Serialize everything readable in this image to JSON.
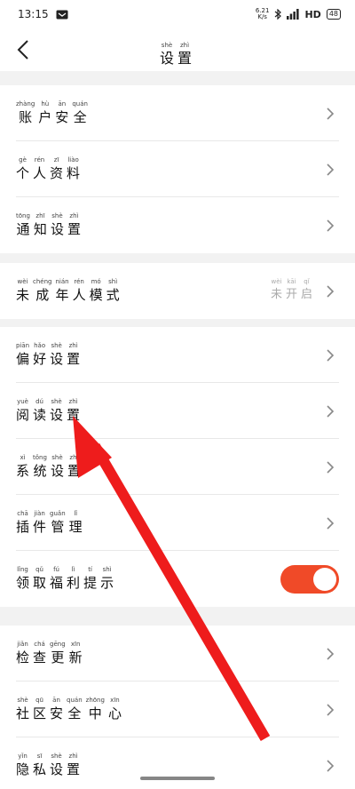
{
  "status": {
    "time": "13:15",
    "net_speed": "6.21",
    "net_unit": "K/s",
    "network": "HD",
    "battery": "48"
  },
  "header": {
    "title": [
      {
        "py": "shè",
        "hz": "设"
      },
      {
        "py": "zhì",
        "hz": "置"
      }
    ]
  },
  "groups": [
    {
      "items": [
        {
          "label": [
            {
              "py": "zhàng",
              "hz": "账"
            },
            {
              "py": "hù",
              "hz": "户"
            },
            {
              "py": "ān",
              "hz": "安"
            },
            {
              "py": "quán",
              "hz": "全"
            }
          ]
        },
        {
          "label": [
            {
              "py": "gè",
              "hz": "个"
            },
            {
              "py": "rén",
              "hz": "人"
            },
            {
              "py": "zī",
              "hz": "资"
            },
            {
              "py": "liào",
              "hz": "料"
            }
          ]
        },
        {
          "label": [
            {
              "py": "tōng",
              "hz": "通"
            },
            {
              "py": "zhī",
              "hz": "知"
            },
            {
              "py": "shè",
              "hz": "设"
            },
            {
              "py": "zhì",
              "hz": "置"
            }
          ]
        }
      ]
    },
    {
      "items": [
        {
          "label": [
            {
              "py": "wèi",
              "hz": "未"
            },
            {
              "py": "chéng",
              "hz": "成"
            },
            {
              "py": "nián",
              "hz": "年"
            },
            {
              "py": "rén",
              "hz": "人"
            },
            {
              "py": "mó",
              "hz": "模"
            },
            {
              "py": "shì",
              "hz": "式"
            }
          ],
          "value": [
            {
              "py": "wèi",
              "hz": "未"
            },
            {
              "py": "kāi",
              "hz": "开"
            },
            {
              "py": "qǐ",
              "hz": "启"
            }
          ]
        }
      ]
    },
    {
      "items": [
        {
          "label": [
            {
              "py": "piān",
              "hz": "偏"
            },
            {
              "py": "hǎo",
              "hz": "好"
            },
            {
              "py": "shè",
              "hz": "设"
            },
            {
              "py": "zhì",
              "hz": "置"
            }
          ]
        },
        {
          "label": [
            {
              "py": "yuè",
              "hz": "阅"
            },
            {
              "py": "dú",
              "hz": "读"
            },
            {
              "py": "shè",
              "hz": "设"
            },
            {
              "py": "zhì",
              "hz": "置"
            }
          ]
        },
        {
          "label": [
            {
              "py": "xì",
              "hz": "系"
            },
            {
              "py": "tǒng",
              "hz": "统"
            },
            {
              "py": "shè",
              "hz": "设"
            },
            {
              "py": "zhì",
              "hz": "置"
            }
          ]
        },
        {
          "label": [
            {
              "py": "chā",
              "hz": "插"
            },
            {
              "py": "jiàn",
              "hz": "件"
            },
            {
              "py": "guǎn",
              "hz": "管"
            },
            {
              "py": "lǐ",
              "hz": "理"
            }
          ]
        },
        {
          "label": [
            {
              "py": "lǐng",
              "hz": "领"
            },
            {
              "py": "qǔ",
              "hz": "取"
            },
            {
              "py": "fú",
              "hz": "福"
            },
            {
              "py": "lì",
              "hz": "利"
            },
            {
              "py": "tí",
              "hz": "提"
            },
            {
              "py": "shì",
              "hz": "示"
            }
          ],
          "toggle": true
        }
      ]
    },
    {
      "items": [
        {
          "label": [
            {
              "py": "jiǎn",
              "hz": "检"
            },
            {
              "py": "chá",
              "hz": "查"
            },
            {
              "py": "gēng",
              "hz": "更"
            },
            {
              "py": "xīn",
              "hz": "新"
            }
          ]
        },
        {
          "label": [
            {
              "py": "shè",
              "hz": "社"
            },
            {
              "py": "qū",
              "hz": "区"
            },
            {
              "py": "ān",
              "hz": "安"
            },
            {
              "py": "quán",
              "hz": "全"
            },
            {
              "py": "zhōng",
              "hz": "中"
            },
            {
              "py": "xīn",
              "hz": "心"
            }
          ]
        },
        {
          "label": [
            {
              "py": "yǐn",
              "hz": "隐"
            },
            {
              "py": "sī",
              "hz": "私"
            },
            {
              "py": "shè",
              "hz": "设"
            },
            {
              "py": "zhì",
              "hz": "置"
            }
          ]
        }
      ]
    }
  ],
  "colors": {
    "accent": "#f04a28",
    "arrow": "#ee1c1c",
    "background": "#f2f2f2"
  }
}
